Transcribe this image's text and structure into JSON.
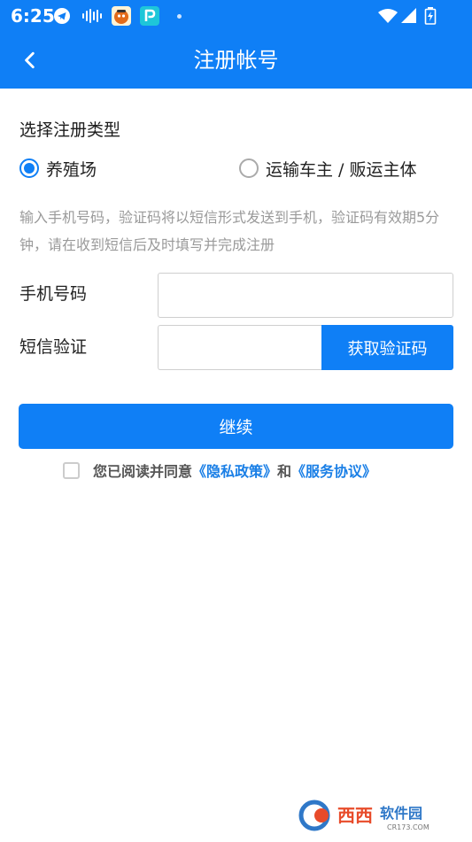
{
  "status_bar": {
    "time": "6:25",
    "icons": [
      "telegram-icon",
      "audio-wave-icon",
      "app-avatar-icon",
      "pay-app-icon",
      "notification-dot-icon",
      "wifi-icon",
      "cell-signal-icon",
      "battery-charging-icon"
    ]
  },
  "app_bar": {
    "title": "注册帐号",
    "back_icon": "chevron-left-icon"
  },
  "register_type": {
    "title": "选择注册类型",
    "options": [
      {
        "label": "养殖场",
        "selected": true
      },
      {
        "label": "运输车主 / 贩运主体",
        "selected": false
      }
    ]
  },
  "hint": "输入手机号码，验证码将以短信形式发送到手机，验证码有效期5分钟，请在收到短信后及时填写并完成注册",
  "phone": {
    "label": "手机号码",
    "value": "",
    "placeholder": ""
  },
  "sms": {
    "label": "短信验证",
    "value": "",
    "placeholder": "",
    "button_label": "获取验证码"
  },
  "continue_label": "继续",
  "agreement": {
    "checked": false,
    "prefix": "您已阅读并同意",
    "privacy_link": "《隐私政策》",
    "joiner": "和",
    "service_link": "《服务协议》"
  },
  "watermark": {
    "text": "西西软件园",
    "subtext": "CR173.COM"
  },
  "colors": {
    "primary": "#0f7ff6",
    "link": "#1a7fe6",
    "hint_text": "#9a9a9a"
  }
}
